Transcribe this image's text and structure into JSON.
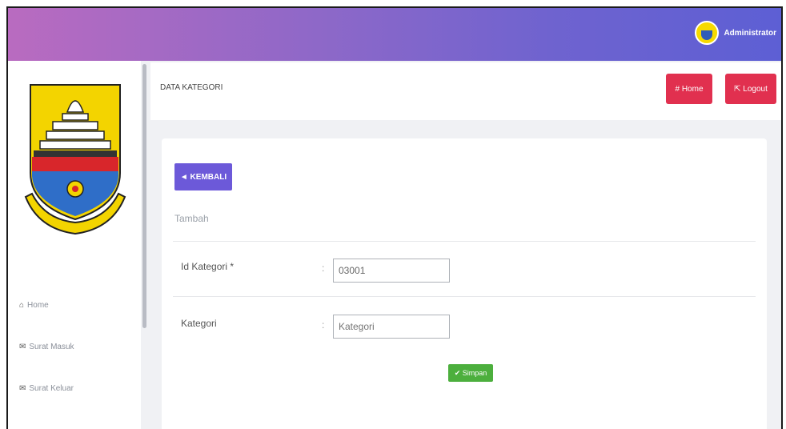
{
  "topbar": {
    "admin_name": "Administrator"
  },
  "sidebar": {
    "items": [
      {
        "icon": "home-icon",
        "glyph": "⌂",
        "label": "Home"
      },
      {
        "icon": "mail-icon",
        "glyph": "✉",
        "label": "Surat Masuk"
      },
      {
        "icon": "mail-icon",
        "glyph": "✉",
        "label": "Surat Keluar"
      }
    ]
  },
  "header": {
    "title": "DATA KATEGORI",
    "home_button": "# Home",
    "logout_button": "⇱ Logout"
  },
  "form": {
    "back_button": "◄ KEMBALI",
    "subtitle": "Tambah",
    "fields": [
      {
        "label": "Id Kategori *",
        "value": "03001"
      },
      {
        "label": "Kategori",
        "value": "",
        "placeholder": "Kategori"
      }
    ],
    "save_button": "✔ Simpan"
  },
  "colors": {
    "topbar_start": "#b96bc0",
    "topbar_end": "#5d5fd4",
    "danger": "#e1304f",
    "primary": "#6c59d9",
    "success": "#4caf3d"
  }
}
